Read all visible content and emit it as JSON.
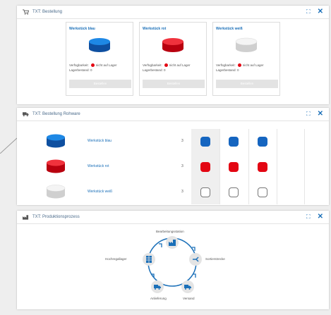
{
  "colors": {
    "accent": "#1a6fb8",
    "blue": "#1565c0",
    "red": "#e30613",
    "white": "#f2f2f2"
  },
  "bestellung": {
    "title": "TXT: Bestellung",
    "cards": [
      {
        "title": "Werkstück blau",
        "color": "blue",
        "availability_label": "Verfügbarkeit:",
        "availability_value": "nicht auf Lager",
        "stock_label": "Lagerbestand:",
        "stock_value": "0",
        "button": "Bestellen"
      },
      {
        "title": "Werkstück rot",
        "color": "red",
        "availability_label": "Verfügbarkeit:",
        "availability_value": "nicht auf Lager",
        "stock_label": "Lagerbestand:",
        "stock_value": "0",
        "button": "Bestellen"
      },
      {
        "title": "Werkstück weiß",
        "color": "white",
        "availability_label": "Verfügbarkeit:",
        "availability_value": "nicht auf Lager",
        "stock_label": "Lagerbestand:",
        "stock_value": "0",
        "button": "Bestellen"
      }
    ]
  },
  "rohware": {
    "title": "TXT: Bestellung Rohware",
    "rows": [
      {
        "label": "Werkstück blau",
        "count": "3",
        "color": "blue"
      },
      {
        "label": "Werkstück rot",
        "count": "3",
        "color": "red"
      },
      {
        "label": "Werkstück weiß",
        "count": "3",
        "color": "white"
      }
    ]
  },
  "produktion": {
    "title": "TXT: Produktionsprozess",
    "nodes": {
      "bearbeitung": "Bearbeitungsstation",
      "sortier": "Sortierstrecke",
      "versand": "Versand",
      "anlieferung": "Anlieferung",
      "hochregal": "Hochregallager"
    }
  },
  "controls": {
    "expand": "⛶",
    "close": "✕"
  }
}
